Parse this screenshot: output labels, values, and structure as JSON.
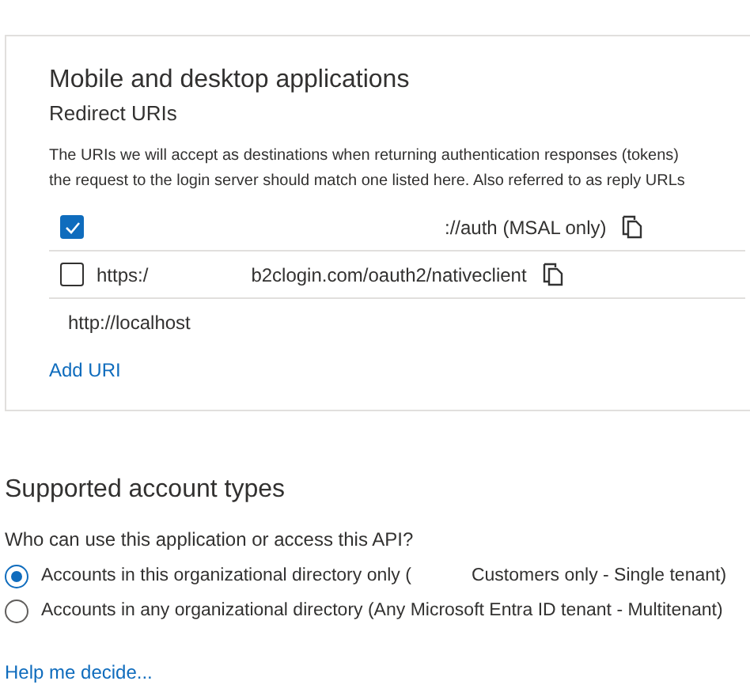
{
  "platform_card": {
    "title": "Mobile and desktop applications",
    "subtitle": "Redirect URIs",
    "description": [
      "The URIs we will accept as destinations when returning authentication responses (tokens)",
      "the request to the login server should match one listed here. Also referred to as reply URLs"
    ],
    "uris": [
      {
        "kind": "checkbox",
        "checked": true,
        "suffix": "://auth (MSAL only)"
      },
      {
        "kind": "checkbox",
        "checked": false,
        "prefix": "https:/",
        "suffix": "b2clogin.com/oauth2/nativeclient"
      },
      {
        "kind": "plain",
        "value": "http://localhost"
      }
    ],
    "add_link": "Add URI"
  },
  "account_types": {
    "title": "Supported account types",
    "question": "Who can use this application or access this API?",
    "options": [
      {
        "selected": true,
        "label": "Accounts in this organizational directory only (",
        "label_tail": "Customers only - Single tenant)"
      },
      {
        "selected": false,
        "label": "Accounts in any organizational directory (Any Microsoft Entra ID tenant - Multitenant)"
      }
    ],
    "help_link": "Help me decide..."
  }
}
